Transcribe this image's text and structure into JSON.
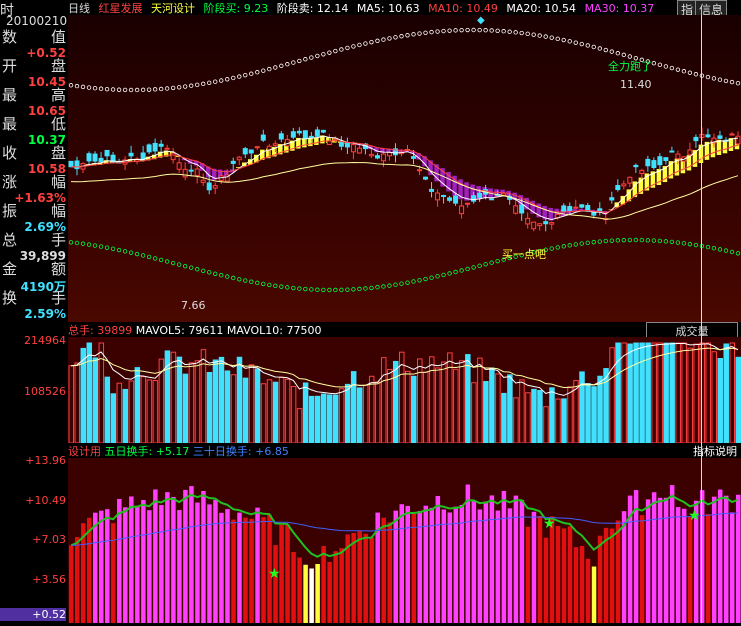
{
  "window": {
    "title": "日线"
  },
  "header": {
    "date": "20100210",
    "period": "日线",
    "indicator_a": "红星发展",
    "indicator_b": "天河设计",
    "buy_label": "阶段买: 9.23",
    "sell_label": "阶段卖: 12.14",
    "ma5": "MA5: 10.63",
    "ma10": "MA10: 10.49",
    "ma20": "MA20: 10.54",
    "ma30": "MA30: 10.37",
    "btn_zhi": "指",
    "btn_info": "信息"
  },
  "left_panel": {
    "title_side": "时",
    "items": [
      {
        "name_a": "数",
        "name_b": "值",
        "value": "+0.52",
        "color": "#ff4040"
      },
      {
        "name_a": "开",
        "name_b": "盘",
        "value": "10.45",
        "color": "#ff4040"
      },
      {
        "name_a": "最",
        "name_b": "高",
        "value": "10.65",
        "color": "#ff4040"
      },
      {
        "name_a": "最",
        "name_b": "低",
        "value": "10.37",
        "color": "#00ff40"
      },
      {
        "name_a": "收",
        "name_b": "盘",
        "value": "10.58",
        "color": "#ff4040"
      },
      {
        "name_a": "涨",
        "name_b": "幅",
        "value": "+1.63%",
        "color": "#ff4040"
      },
      {
        "name_a": "振",
        "name_b": "幅",
        "value": "2.69%",
        "color": "#40e0ff"
      },
      {
        "name_a": "总",
        "name_b": "手",
        "value": "39,899",
        "color": "#dddddd"
      },
      {
        "name_a": "金",
        "name_b": "额",
        "value": "4190万",
        "color": "#40e0ff"
      },
      {
        "name_a": "换",
        "name_b": "手",
        "value": "2.59%",
        "color": "#40e0ff"
      }
    ]
  },
  "main_chart": {
    "annotations": {
      "high": "11.40",
      "low": "7.66",
      "top_signal": "全力跑了",
      "bottom_signal": "买一点吧"
    }
  },
  "volume": {
    "title": "总手: 39899",
    "mavol5": "MAVOL5: 79611",
    "mavol10": "MAVOL10: 77500",
    "selector": "成交量",
    "axis": [
      "214964",
      "108526"
    ]
  },
  "indicator": {
    "title": "设计用",
    "five_day": "五日换手: +5.17",
    "thirty_day": "三十日换手: +6.85",
    "help": "指标说明",
    "axis": [
      "+13.96",
      "+10.49",
      "+7.03",
      "+3.56",
      "+0.52"
    ]
  },
  "colors": {
    "up": "#ff4040",
    "down": "#40e0ff",
    "ma_purple": "#ff40ff",
    "green": "#00ff40",
    "yellow": "#ffff00"
  }
}
